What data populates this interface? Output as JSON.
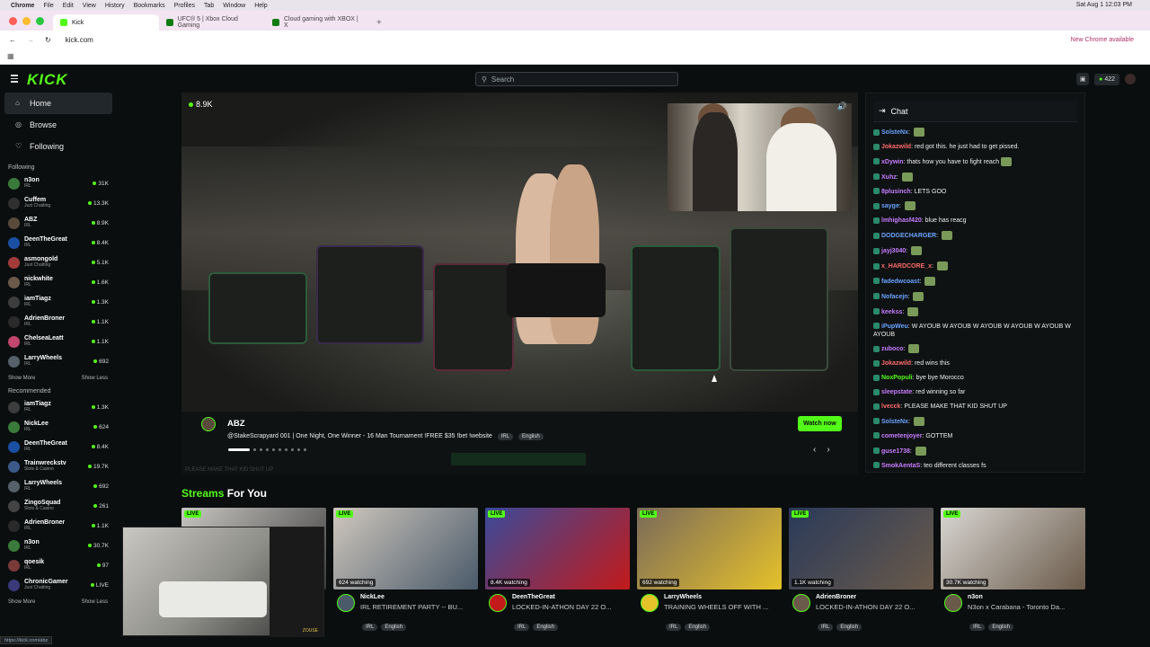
{
  "mac_menu": [
    "Chrome",
    "File",
    "Edit",
    "View",
    "History",
    "Bookmarks",
    "Profiles",
    "Tab",
    "Window",
    "Help"
  ],
  "clock": "Sat Aug 1  12:03 PM",
  "browser_tabs": [
    {
      "label": "Kick",
      "color": "#53fc18"
    },
    {
      "label": "UFC® 5 | Xbox Cloud Gaming",
      "color": "#107c10"
    },
    {
      "label": "Cloud gaming with XBOX | X",
      "color": "#107c10"
    }
  ],
  "address": "kick.com",
  "update_chip": "New Chrome available",
  "logo": "KICK",
  "search": {
    "placeholder": "Search"
  },
  "points": "422",
  "nav": {
    "home": "Home",
    "browse": "Browse",
    "following": "Following"
  },
  "following_label": "Following",
  "following": [
    {
      "name": "n3on",
      "cat": "IRL",
      "viewers": "31K",
      "color": "#3a7a3a"
    },
    {
      "name": "Cuffem",
      "cat": "Just Chatting",
      "viewers": "13.3K",
      "color": "#2f2f2f"
    },
    {
      "name": "ABZ",
      "cat": "IRL",
      "viewers": "8.9K",
      "color": "#5a4a3c"
    },
    {
      "name": "DeenTheGreat",
      "cat": "IRL",
      "viewers": "8.4K",
      "color": "#1b4fa3"
    },
    {
      "name": "asmongold",
      "cat": "Just Chatting",
      "viewers": "5.1K",
      "color": "#a33b3b"
    },
    {
      "name": "nickwhite",
      "cat": "IRL",
      "viewers": "1.6K",
      "color": "#6b5a4a"
    },
    {
      "name": "iamTiagz",
      "cat": "IRL",
      "viewers": "1.3K",
      "color": "#3d3d3d"
    },
    {
      "name": "AdrienBroner",
      "cat": "IRL",
      "viewers": "1.1K",
      "color": "#2a2a2a"
    },
    {
      "name": "ChelseaLeatt",
      "cat": "IRL",
      "viewers": "1.1K",
      "color": "#c2466e"
    },
    {
      "name": "LarryWheels",
      "cat": "IRL",
      "viewers": "692",
      "color": "#55606a"
    }
  ],
  "show_more": "Show More",
  "show_less": "Show Less",
  "recommended_label": "Recommended",
  "recommended": [
    {
      "name": "iamTiagz",
      "cat": "IRL",
      "viewers": "1.3K",
      "color": "#3d3d3d"
    },
    {
      "name": "NickLee",
      "cat": "IRL",
      "viewers": "624",
      "color": "#3a7a3a"
    },
    {
      "name": "DeenTheGreat",
      "cat": "IRL",
      "viewers": "8.4K",
      "color": "#1b4fa3"
    },
    {
      "name": "Trainwreckstv",
      "cat": "Slots & Casino",
      "viewers": "19.7K",
      "color": "#3b5a8a"
    },
    {
      "name": "LarryWheels",
      "cat": "IRL",
      "viewers": "692",
      "color": "#55606a"
    },
    {
      "name": "ZingoSquad",
      "cat": "Slots & Casino",
      "viewers": "261",
      "color": "#444"
    },
    {
      "name": "AdrienBroner",
      "cat": "IRL",
      "viewers": "1.1K",
      "color": "#2a2a2a"
    },
    {
      "name": "n3on",
      "cat": "IRL",
      "viewers": "30.7K",
      "color": "#3a7a3a"
    },
    {
      "name": "qoesik",
      "cat": "IRL",
      "viewers": "97",
      "color": "#7a3a3a"
    },
    {
      "name": "ChronicGamer",
      "cat": "Just Chatting",
      "viewers": "LIVE",
      "color": "#3a3a7a"
    }
  ],
  "player": {
    "viewers": "8.9K"
  },
  "featured": {
    "name": "ABZ",
    "title": "@StakeScrapyard 001 | One Night, One Winner - 16 Man Tournament !FREE $35 !bet !website",
    "tags": [
      "IRL",
      "English"
    ],
    "watch_label": "Watch now",
    "ghost_text": "PLEASE MAKE THAT KID SHUT UP"
  },
  "chat": {
    "title": "Chat",
    "messages": [
      {
        "user": "SolsteNx",
        "color": "#6aa3ff",
        "text": "",
        "emote": true
      },
      {
        "user": "Jokazwild",
        "color": "#ff6b6b",
        "text": "red got this. he just had to get pissed."
      },
      {
        "user": "xDywin",
        "color": "#c77dff",
        "text": "thats how you have to fight reach",
        "emote": true
      },
      {
        "user": "Xuhz",
        "color": "#c77dff",
        "text": "",
        "emote": true
      },
      {
        "user": "8plusinch",
        "color": "#c77dff",
        "text": "LETS GOO"
      },
      {
        "user": "sayge",
        "color": "#6aa3ff",
        "text": "",
        "emote": true
      },
      {
        "user": "lmhighasf420",
        "color": "#c77dff",
        "text": "blue has reacg"
      },
      {
        "user": "DODGECHARGER",
        "color": "#6aa3ff",
        "text": "",
        "emote": true
      },
      {
        "user": "jayj3040",
        "color": "#c77dff",
        "text": "",
        "emote": true
      },
      {
        "user": "x_HARDCORE_x",
        "color": "#ff6b6b",
        "text": "",
        "emote": true
      },
      {
        "user": "fadedwcoast",
        "color": "#6aa3ff",
        "text": "",
        "emote": true
      },
      {
        "user": "Nofacejn",
        "color": "#6aa3ff",
        "text": "",
        "emote": true
      },
      {
        "user": "keekss",
        "color": "#c77dff",
        "text": "",
        "emote": true
      },
      {
        "user": "iPupWeu",
        "color": "#6aa3ff",
        "text": "W AYOUB  W AYOUB  W AYOUB  W AYOUB  W AYOUB  W AYOUB"
      },
      {
        "user": "zuboco",
        "color": "#c77dff",
        "text": "",
        "emote": true
      },
      {
        "user": "Jokazwild",
        "color": "#ff6b6b",
        "text": "red wins this"
      },
      {
        "user": "NoxPopuli",
        "color": "#53fc18",
        "text": "bye bye Morocco"
      },
      {
        "user": "sleepstate",
        "color": "#c77dff",
        "text": "red winning so far"
      },
      {
        "user": "lvecck",
        "color": "#ff6b6b",
        "text": "PLEASE MAKE THAT KID SHUT UP"
      },
      {
        "user": "SolsteNx",
        "color": "#6aa3ff",
        "text": "",
        "emote": true
      },
      {
        "user": "cometenjoyer",
        "color": "#c77dff",
        "text": "GOTTEM"
      },
      {
        "user": "guse1738",
        "color": "#c77dff",
        "text": "",
        "emote": true
      },
      {
        "user": "SmokAentaS",
        "color": "#c77dff",
        "text": "teo different classes fs"
      }
    ]
  },
  "sfy": {
    "accent": "Streams",
    "rest": " For You"
  },
  "cards": [
    {
      "live": "LIVE",
      "watching": "",
      "name": "",
      "title": "",
      "tags": [],
      "c1": "#c8c6c2",
      "c2": "#3a3a3a"
    },
    {
      "live": "LIVE",
      "watching": "624 watching",
      "name": "NickLee",
      "title": "IRL RETIREMENT PARTY -- BU...",
      "tags": [
        "IRL",
        "English"
      ],
      "c1": "#cfc7bd",
      "c2": "#4a5a6a"
    },
    {
      "live": "LIVE",
      "watching": "8.4K watching",
      "name": "DeenTheGreat",
      "title": "LOCKED-IN-ATHON DAY 22 O...",
      "tags": [
        "IRL",
        "English"
      ],
      "c1": "#3a4a9a",
      "c2": "#c21a1a"
    },
    {
      "live": "LIVE",
      "watching": "692 watching",
      "name": "LarryWheels",
      "title": "TRAINING WHEELS OFF WITH ...",
      "tags": [
        "IRL",
        "English"
      ],
      "c1": "#7a6a5a",
      "c2": "#e5c12a"
    },
    {
      "live": "LIVE",
      "watching": "1.1K watching",
      "name": "AdrienBroner",
      "title": "LOCKED-IN-ATHON DAY 22 O...",
      "tags": [
        "IRL",
        "English"
      ],
      "c1": "#2a3a5a",
      "c2": "#6a5a4a"
    },
    {
      "live": "LIVE",
      "watching": "30.7K watching",
      "name": "n3on",
      "title": "N3on x Carabana - Toronto Da...",
      "tags": [
        "IRL",
        "English"
      ],
      "c1": "#d8d6d2",
      "c2": "#6a5a4a"
    }
  ],
  "cam_label": "ZOUSE",
  "status_url": "https://kick.com/abz"
}
